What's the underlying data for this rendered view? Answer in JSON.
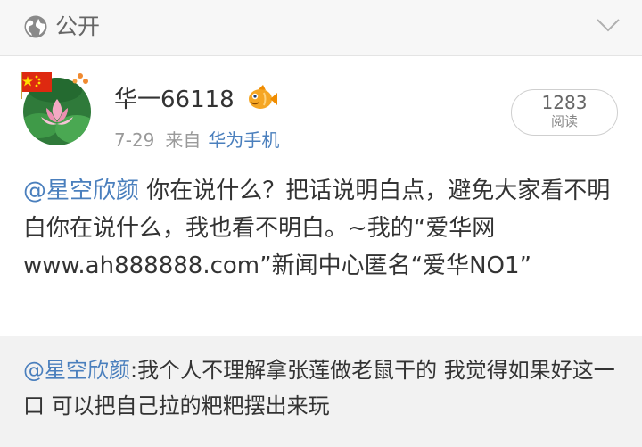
{
  "header": {
    "visibility_label": "公开",
    "globe_icon": "globe-icon",
    "collapse_icon": "chevron-down-icon"
  },
  "post": {
    "username": "华一66118",
    "date": "7-29",
    "from_label": "来自",
    "source": "华为手机",
    "read_count": "1283",
    "read_label": "阅读",
    "mention": "@星空欣颜",
    "body": " 你在说什么？把话说明白点，避免大家看不明白你在说什么，我也看不明白。~我的“爱华网www.ah888888.com”新闻中心匿名“爱华NO1”"
  },
  "repost": {
    "mention": "@星空欣颜",
    "body": ":我个人不理解拿张莲做老鼠干的 我觉得如果好这一口 可以把自己拉的粑粑摆出来玩"
  },
  "colors": {
    "link": "#4a7fbd",
    "header_bg": "#f7f7f7",
    "repost_bg": "#f2f2f2"
  }
}
